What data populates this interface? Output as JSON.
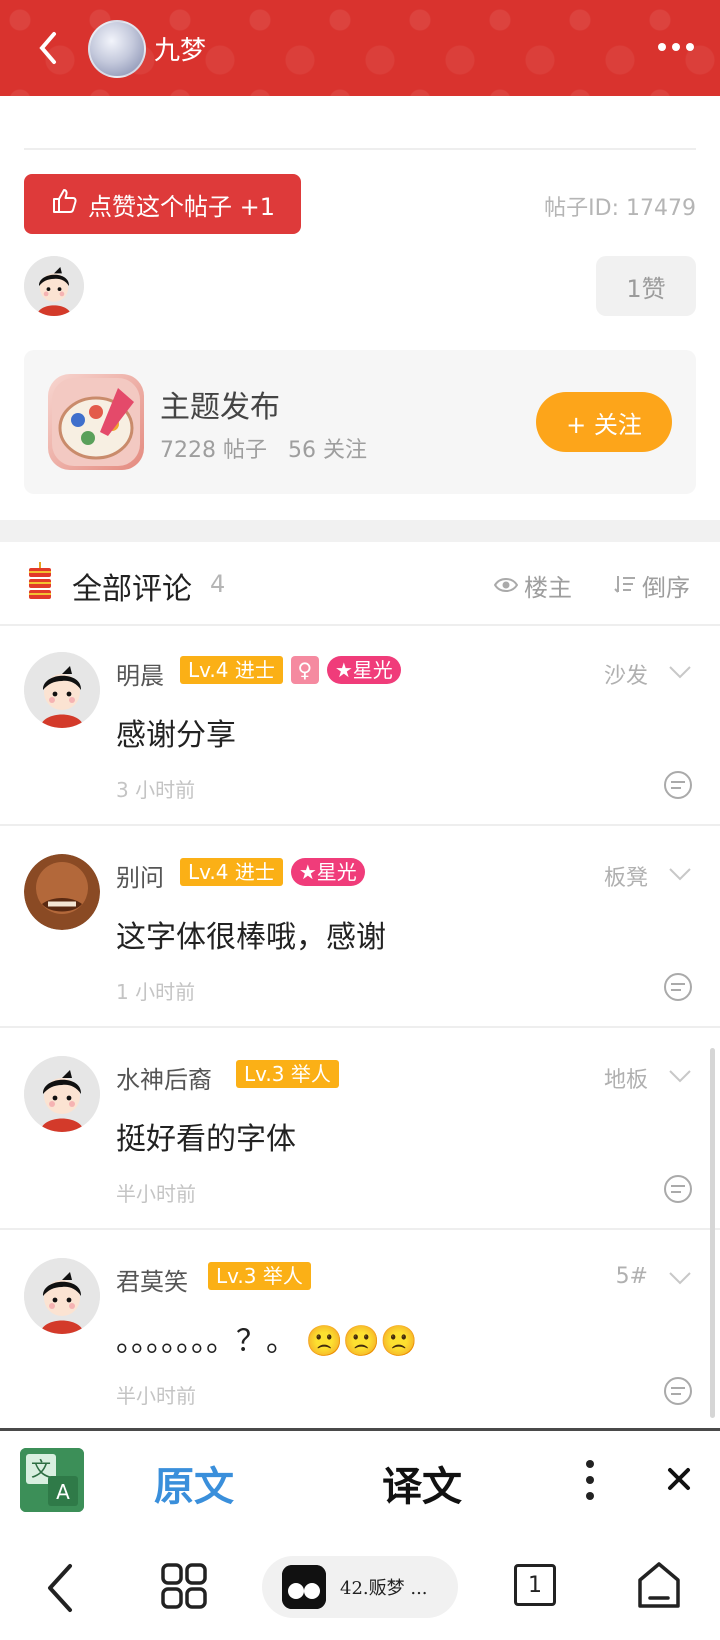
{
  "header": {
    "username": "九梦",
    "icons": [
      "back-arrow-icon",
      "more-icon"
    ]
  },
  "post": {
    "like_button_label": "点赞这个帖子 +1",
    "post_id_label": "帖子ID: 17479",
    "like_count_label": "1赞"
  },
  "topic": {
    "name": "主题发布",
    "stats": "7228 帖子   56 关注",
    "follow_label": "+ 关注"
  },
  "comments_section": {
    "title": "全部评论",
    "count": "4",
    "owner_filter": "楼主",
    "order_filter": "倒序",
    "items": [
      {
        "name": "明晨",
        "level": "Lv.4 进士",
        "gender": "♀",
        "star": "★星光",
        "floor": "沙发",
        "text": "感谢分享",
        "time": "3 小时前"
      },
      {
        "name": "别问",
        "level": "Lv.4 进士",
        "star": "★星光",
        "floor": "板凳",
        "text": "这字体很棒哦，感谢",
        "time": "1 小时前"
      },
      {
        "name": "水神后裔",
        "level": "Lv.3 举人",
        "floor": "地板",
        "text": "挺好看的字体",
        "time": "半小时前"
      },
      {
        "name": "君莫笑",
        "level": "Lv.3 举人",
        "floor": "5#",
        "text": "。。。。。。。？。 🙁🙁🙁",
        "time": "半小时前"
      }
    ]
  },
  "translate_bar": {
    "original_label": "原文",
    "translated_label": "译文"
  },
  "bottom_nav": {
    "tab_label": "42.贩梦 ...",
    "tab_count": "1"
  },
  "colors": {
    "header_red": "#d9332e",
    "like_red": "#de3a3a",
    "follow_orange": "#fda51a",
    "level_badge": "#fbb016",
    "star_badge": "#f03c7a",
    "original_blue": "#3a8fdb"
  }
}
